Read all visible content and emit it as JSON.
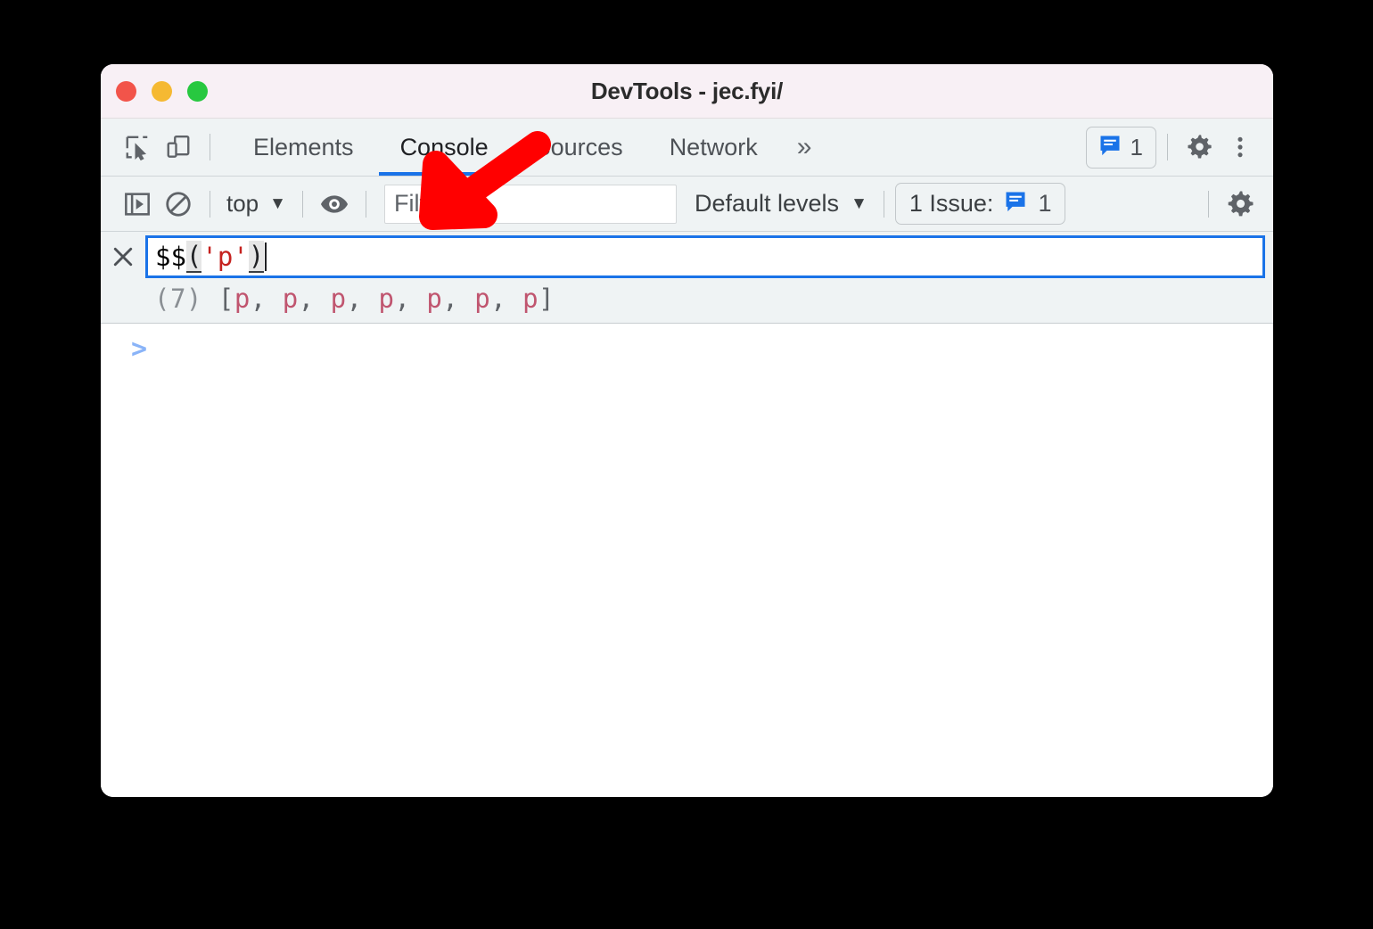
{
  "window": {
    "title": "DevTools - jec.fyi/",
    "traffic_lights": [
      {
        "name": "close",
        "color": "#f2544a"
      },
      {
        "name": "minimize",
        "color": "#f5b932"
      },
      {
        "name": "maximize",
        "color": "#28c840"
      }
    ]
  },
  "tabbar": {
    "left_icons": [
      {
        "name": "inspect-element-icon"
      },
      {
        "name": "device-toolbar-icon"
      }
    ],
    "tabs": [
      {
        "label": "Elements",
        "active": false
      },
      {
        "label": "Console",
        "active": true
      },
      {
        "label": "Sources",
        "active": false
      },
      {
        "label": "Network",
        "active": false
      }
    ],
    "more_tabs_glyph": "»",
    "issues_badge": {
      "count": "1"
    },
    "settings_icon": "gear-icon",
    "more_icon": "kebab-menu-icon",
    "active_underline_color": "#1a73e8"
  },
  "console_toolbar": {
    "sidebar_toggle_icon": "console-sidebar-icon",
    "clear_console_icon": "clear-console-icon",
    "context": {
      "label": "top",
      "caret": "▼"
    },
    "eye_icon": "live-expression-eye-icon",
    "filter": {
      "value": "",
      "placeholder": "Filter"
    },
    "levels": {
      "label": "Default levels",
      "caret": "▼"
    },
    "issues": {
      "label": "1 Issue:",
      "count": "1"
    },
    "settings_icon": "console-settings-gear-icon"
  },
  "console": {
    "eval": {
      "close_glyph": "×",
      "code_tokens": [
        {
          "text": "$$",
          "kind": "identifier"
        },
        {
          "text": "(",
          "kind": "bracket"
        },
        {
          "text": "'p'",
          "kind": "string"
        },
        {
          "text": ")",
          "kind": "bracket"
        }
      ],
      "result": {
        "count": "(7)",
        "open": " [",
        "nodes": [
          "p",
          "p",
          "p",
          "p",
          "p",
          "p",
          "p"
        ],
        "separator": ", ",
        "close": "]"
      }
    },
    "prompt_glyph": ">"
  },
  "annotation": {
    "arrow": {
      "name": "red-pointer-arrow",
      "color": "#ff0000",
      "direction": "down-left",
      "points_at": "console-tab"
    }
  }
}
